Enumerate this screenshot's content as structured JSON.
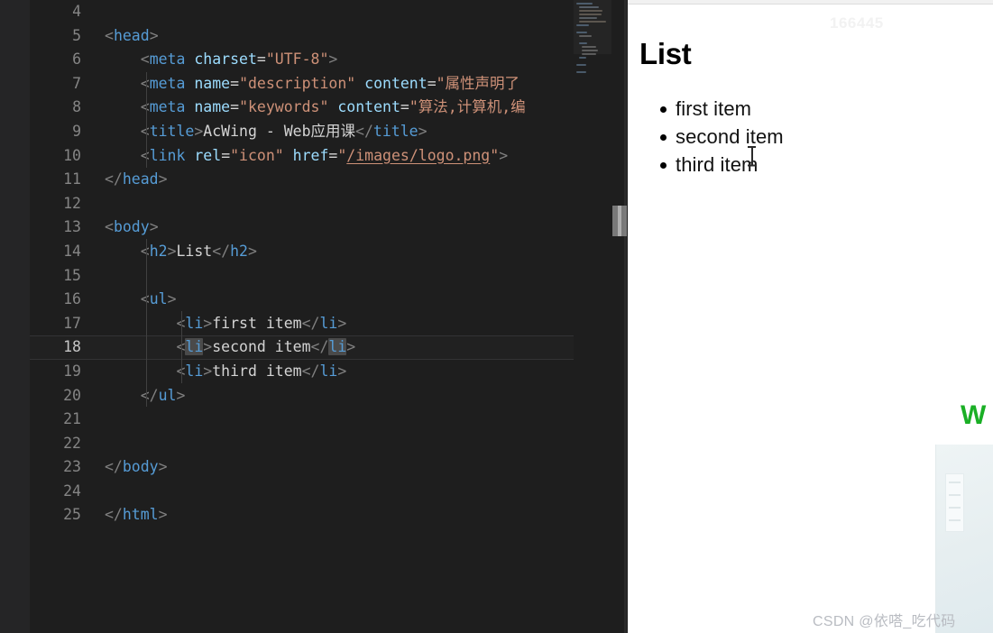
{
  "editor": {
    "language": "html",
    "active_line": 18,
    "colors": {
      "background": "#1e1e1e",
      "gutter_text": "#858585",
      "active_line_bg": "#212121",
      "tag": "#569cd6",
      "attribute": "#9cdcfe",
      "string": "#ce9178",
      "text": "#d4d4d4",
      "punctuation": "#808080",
      "selection_highlight": "#4a4a4a"
    },
    "lines": [
      {
        "number": "4",
        "tokens": []
      },
      {
        "number": "5",
        "tokens": [
          {
            "t": "punc",
            "v": "<"
          },
          {
            "t": "tag",
            "v": "head"
          },
          {
            "t": "punc",
            "v": ">"
          }
        ]
      },
      {
        "number": "6",
        "tokens": [
          {
            "t": "txt",
            "v": "    "
          },
          {
            "t": "punc",
            "v": "<"
          },
          {
            "t": "tag",
            "v": "meta"
          },
          {
            "t": "txt",
            "v": " "
          },
          {
            "t": "attr",
            "v": "charset"
          },
          {
            "t": "eq",
            "v": "="
          },
          {
            "t": "str",
            "v": "\"UTF-8\""
          },
          {
            "t": "punc",
            "v": ">"
          }
        ]
      },
      {
        "number": "7",
        "tokens": [
          {
            "t": "txt",
            "v": "    "
          },
          {
            "t": "punc",
            "v": "<"
          },
          {
            "t": "tag",
            "v": "meta"
          },
          {
            "t": "txt",
            "v": " "
          },
          {
            "t": "attr",
            "v": "name"
          },
          {
            "t": "eq",
            "v": "="
          },
          {
            "t": "str",
            "v": "\"description\""
          },
          {
            "t": "txt",
            "v": " "
          },
          {
            "t": "attr",
            "v": "content"
          },
          {
            "t": "eq",
            "v": "="
          },
          {
            "t": "str",
            "v": "\"属性声明了"
          }
        ]
      },
      {
        "number": "8",
        "tokens": [
          {
            "t": "txt",
            "v": "    "
          },
          {
            "t": "punc",
            "v": "<"
          },
          {
            "t": "tag",
            "v": "meta"
          },
          {
            "t": "txt",
            "v": " "
          },
          {
            "t": "attr",
            "v": "name"
          },
          {
            "t": "eq",
            "v": "="
          },
          {
            "t": "str",
            "v": "\"keywords\""
          },
          {
            "t": "txt",
            "v": " "
          },
          {
            "t": "attr",
            "v": "content"
          },
          {
            "t": "eq",
            "v": "="
          },
          {
            "t": "str",
            "v": "\"算法,计算机,编"
          }
        ]
      },
      {
        "number": "9",
        "tokens": [
          {
            "t": "txt",
            "v": "    "
          },
          {
            "t": "punc",
            "v": "<"
          },
          {
            "t": "tag",
            "v": "title"
          },
          {
            "t": "punc",
            "v": ">"
          },
          {
            "t": "txt",
            "v": "AcWing - Web应用课"
          },
          {
            "t": "punc",
            "v": "</"
          },
          {
            "t": "tag",
            "v": "title"
          },
          {
            "t": "punc",
            "v": ">"
          }
        ]
      },
      {
        "number": "10",
        "tokens": [
          {
            "t": "txt",
            "v": "    "
          },
          {
            "t": "punc",
            "v": "<"
          },
          {
            "t": "tag",
            "v": "link"
          },
          {
            "t": "txt",
            "v": " "
          },
          {
            "t": "attr",
            "v": "rel"
          },
          {
            "t": "eq",
            "v": "="
          },
          {
            "t": "str",
            "v": "\"icon\""
          },
          {
            "t": "txt",
            "v": " "
          },
          {
            "t": "attr",
            "v": "href"
          },
          {
            "t": "eq",
            "v": "="
          },
          {
            "t": "str",
            "v": "\""
          },
          {
            "t": "link",
            "v": "/images/logo.png"
          },
          {
            "t": "str",
            "v": "\""
          },
          {
            "t": "punc",
            "v": ">"
          }
        ]
      },
      {
        "number": "11",
        "tokens": [
          {
            "t": "punc",
            "v": "</"
          },
          {
            "t": "tag",
            "v": "head"
          },
          {
            "t": "punc",
            "v": ">"
          }
        ]
      },
      {
        "number": "12",
        "tokens": []
      },
      {
        "number": "13",
        "tokens": [
          {
            "t": "punc",
            "v": "<"
          },
          {
            "t": "tag",
            "v": "body"
          },
          {
            "t": "punc",
            "v": ">"
          }
        ]
      },
      {
        "number": "14",
        "tokens": [
          {
            "t": "txt",
            "v": "    "
          },
          {
            "t": "punc",
            "v": "<"
          },
          {
            "t": "tag",
            "v": "h2"
          },
          {
            "t": "punc",
            "v": ">"
          },
          {
            "t": "txt",
            "v": "List"
          },
          {
            "t": "punc",
            "v": "</"
          },
          {
            "t": "tag",
            "v": "h2"
          },
          {
            "t": "punc",
            "v": ">"
          }
        ]
      },
      {
        "number": "15",
        "tokens": []
      },
      {
        "number": "16",
        "tokens": [
          {
            "t": "txt",
            "v": "    "
          },
          {
            "t": "punc",
            "v": "<"
          },
          {
            "t": "tag",
            "v": "ul"
          },
          {
            "t": "punc",
            "v": ">"
          }
        ]
      },
      {
        "number": "17",
        "tokens": [
          {
            "t": "txt",
            "v": "        "
          },
          {
            "t": "punc",
            "v": "<"
          },
          {
            "t": "tag",
            "v": "li"
          },
          {
            "t": "punc",
            "v": ">"
          },
          {
            "t": "txt",
            "v": "first item"
          },
          {
            "t": "punc",
            "v": "</"
          },
          {
            "t": "tag",
            "v": "li"
          },
          {
            "t": "punc",
            "v": ">"
          }
        ]
      },
      {
        "number": "18",
        "active": true,
        "tokens": [
          {
            "t": "txt",
            "v": "        "
          },
          {
            "t": "punc",
            "v": "<"
          },
          {
            "t": "tag hl",
            "v": "li"
          },
          {
            "t": "punc",
            "v": ">"
          },
          {
            "t": "txt",
            "v": "second item"
          },
          {
            "t": "punc",
            "v": "</"
          },
          {
            "t": "tag hl",
            "v": "li"
          },
          {
            "t": "punc",
            "v": ">"
          }
        ]
      },
      {
        "number": "19",
        "tokens": [
          {
            "t": "txt",
            "v": "        "
          },
          {
            "t": "punc",
            "v": "<"
          },
          {
            "t": "tag",
            "v": "li"
          },
          {
            "t": "punc",
            "v": ">"
          },
          {
            "t": "txt",
            "v": "third item"
          },
          {
            "t": "punc",
            "v": "</"
          },
          {
            "t": "tag",
            "v": "li"
          },
          {
            "t": "punc",
            "v": ">"
          }
        ]
      },
      {
        "number": "20",
        "tokens": [
          {
            "t": "txt",
            "v": "    "
          },
          {
            "t": "punc",
            "v": "</"
          },
          {
            "t": "tag",
            "v": "ul"
          },
          {
            "t": "punc",
            "v": ">"
          }
        ]
      },
      {
        "number": "21",
        "tokens": []
      },
      {
        "number": "22",
        "tokens": []
      },
      {
        "number": "23",
        "tokens": [
          {
            "t": "punc",
            "v": "</"
          },
          {
            "t": "tag",
            "v": "body"
          },
          {
            "t": "punc",
            "v": ">"
          }
        ]
      },
      {
        "number": "24",
        "tokens": []
      },
      {
        "number": "25",
        "tokens": [
          {
            "t": "punc",
            "v": "</"
          },
          {
            "t": "tag",
            "v": "html"
          },
          {
            "t": "punc",
            "v": ">"
          }
        ]
      }
    ]
  },
  "browser": {
    "heading": "List",
    "list_items": [
      "first item",
      "second item",
      "third item"
    ],
    "watermark_top": "166445",
    "watermark_csdn": "CSDN @依嗒_吃代码",
    "badge_letter": "W",
    "badge_color": "#1aaf25"
  }
}
